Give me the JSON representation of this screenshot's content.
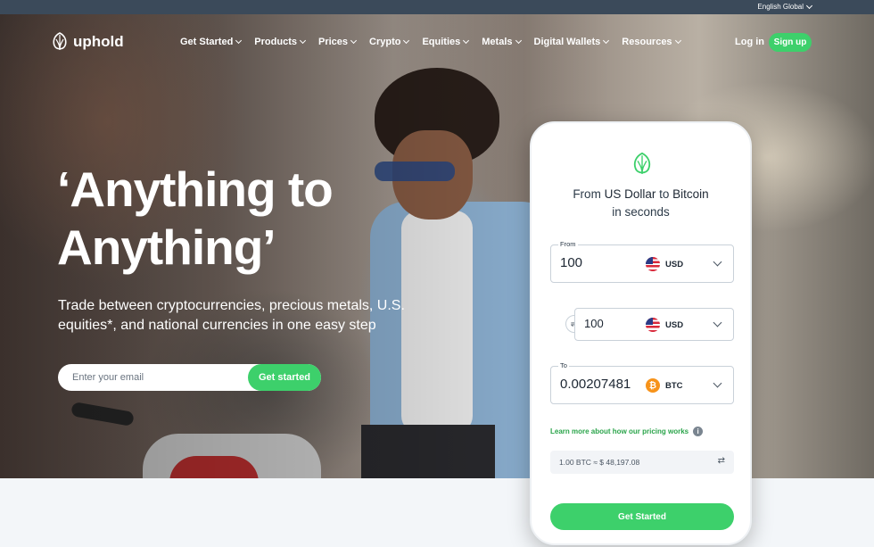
{
  "topbar": {
    "language": "English Global"
  },
  "brand": {
    "name": "uphold",
    "accent": "#3dd06b"
  },
  "nav": {
    "items": [
      {
        "label": "Get Started"
      },
      {
        "label": "Products"
      },
      {
        "label": "Prices"
      },
      {
        "label": "Crypto"
      },
      {
        "label": "Equities"
      },
      {
        "label": "Metals"
      },
      {
        "label": "Digital Wallets"
      },
      {
        "label": "Resources"
      }
    ],
    "login": "Log in",
    "signup": "Sign up"
  },
  "hero": {
    "headline_line1": "‘Anything to",
    "headline_line2": "Anything’",
    "subtitle": "Trade between cryptocurrencies, precious metals, U.S. equities*, and national currencies in one easy step",
    "email_placeholder": "Enter your email",
    "cta": "Get started"
  },
  "converter": {
    "title_prefix": "From",
    "from_currency_name": "US Dollar",
    "title_mid": "to",
    "to_currency_name": "Bitcoin",
    "title_suffix": "in seconds",
    "from": {
      "label": "From",
      "amount": "100",
      "currency": "USD"
    },
    "middle": {
      "amount": "100",
      "currency": "USD"
    },
    "to": {
      "label": "To",
      "amount": "0.00207481",
      "currency": "BTC"
    },
    "learn_more": "Learn more about how our pricing works",
    "rate": "1.00 BTC ≈ $ 48,197.08",
    "cta": "Get Started"
  }
}
